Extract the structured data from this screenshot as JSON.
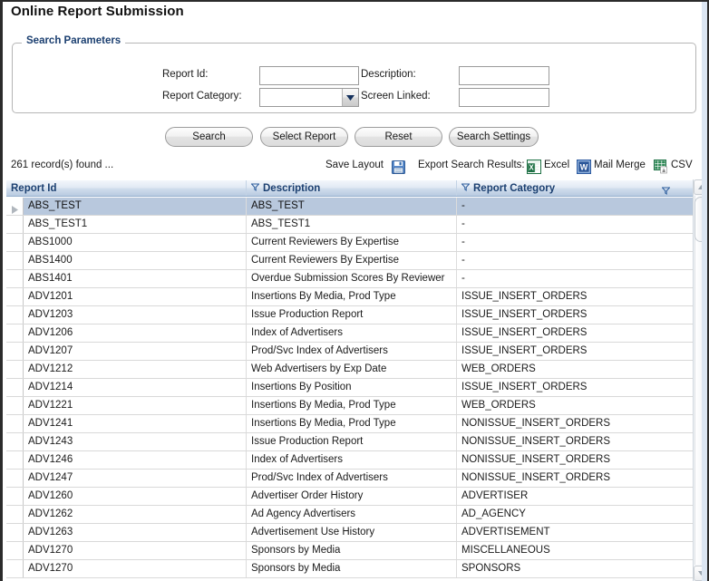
{
  "page": {
    "title": "Online Report Submission"
  },
  "search_panel": {
    "legend": "Search Parameters",
    "fields": {
      "report_id": {
        "label": "Report Id:",
        "value": "",
        "placeholder": ""
      },
      "report_category": {
        "label": "Report Category:",
        "value": "",
        "selected_option": ""
      },
      "description": {
        "label": "Description:",
        "value": "",
        "placeholder": ""
      },
      "screen_linked": {
        "label": "Screen Linked:",
        "value": "",
        "placeholder": ""
      }
    }
  },
  "buttons": {
    "search": "Search",
    "select_report": "Select Report",
    "reset": "Reset",
    "search_settings": "Search Settings"
  },
  "toolbar": {
    "record_count": "261 record(s) found ...",
    "save_layout_label": "Save Layout",
    "save_layout_icon": "floppy-disk-icon",
    "export_label": "Export Search Results:",
    "export_options": [
      {
        "label": "Excel",
        "icon": "excel-icon"
      },
      {
        "label": "Mail Merge",
        "icon": "word-icon"
      },
      {
        "label": "CSV",
        "icon": "csv-icon"
      }
    ]
  },
  "grid": {
    "columns": [
      {
        "key": "report_id",
        "label": "Report Id",
        "filter_icon": "funnel-icon",
        "filter_position": "right"
      },
      {
        "key": "description",
        "label": "Description",
        "filter_icon": "funnel-icon",
        "filter_position": "left"
      },
      {
        "key": "report_category",
        "label": "Report Category",
        "filter_icon": "funnel-icon",
        "filter_position": "left"
      }
    ],
    "selected_row_index": 0,
    "rows": [
      {
        "report_id": "ABS_TEST",
        "description": "ABS_TEST",
        "report_category": "-"
      },
      {
        "report_id": "ABS_TEST1",
        "description": "ABS_TEST1",
        "report_category": "-"
      },
      {
        "report_id": "ABS1000",
        "description": "Current Reviewers By Expertise",
        "report_category": "-"
      },
      {
        "report_id": "ABS1400",
        "description": "Current Reviewers By Expertise",
        "report_category": "-"
      },
      {
        "report_id": "ABS1401",
        "description": "Overdue Submission Scores By Reviewer",
        "report_category": "-"
      },
      {
        "report_id": "ADV1201",
        "description": "Insertions By Media, Prod Type",
        "report_category": "ISSUE_INSERT_ORDERS"
      },
      {
        "report_id": "ADV1203",
        "description": "Issue Production Report",
        "report_category": "ISSUE_INSERT_ORDERS"
      },
      {
        "report_id": "ADV1206",
        "description": "Index of Advertisers",
        "report_category": "ISSUE_INSERT_ORDERS"
      },
      {
        "report_id": "ADV1207",
        "description": "Prod/Svc Index of Advertisers",
        "report_category": "ISSUE_INSERT_ORDERS"
      },
      {
        "report_id": "ADV1212",
        "description": "Web Advertisers by Exp Date",
        "report_category": "WEB_ORDERS"
      },
      {
        "report_id": "ADV1214",
        "description": "Insertions By Position",
        "report_category": "ISSUE_INSERT_ORDERS"
      },
      {
        "report_id": "ADV1221",
        "description": "Insertions By Media, Prod Type",
        "report_category": "WEB_ORDERS"
      },
      {
        "report_id": "ADV1241",
        "description": "Insertions By Media, Prod Type",
        "report_category": "NONISSUE_INSERT_ORDERS"
      },
      {
        "report_id": "ADV1243",
        "description": "Issue Production Report",
        "report_category": "NONISSUE_INSERT_ORDERS"
      },
      {
        "report_id": "ADV1246",
        "description": "Index of Advertisers",
        "report_category": "NONISSUE_INSERT_ORDERS"
      },
      {
        "report_id": "ADV1247",
        "description": "Prod/Svc Index of Advertisers",
        "report_category": "NONISSUE_INSERT_ORDERS"
      },
      {
        "report_id": "ADV1260",
        "description": "Advertiser Order History",
        "report_category": "ADVERTISER"
      },
      {
        "report_id": "ADV1262",
        "description": "Ad Agency Advertisers",
        "report_category": "AD_AGENCY"
      },
      {
        "report_id": "ADV1263",
        "description": "Advertisement Use History",
        "report_category": "ADVERTISEMENT"
      },
      {
        "report_id": "ADV1270",
        "description": "Sponsors by Media",
        "report_category": "MISCELLANEOUS"
      },
      {
        "report_id": "ADV1270",
        "description": "Sponsors by Media",
        "report_category": "SPONSORS"
      }
    ]
  },
  "colors": {
    "header_text": "#1b3f70",
    "selected_row": "#b8c8dd",
    "panel_border": "#b5b5b5",
    "excel_green": "#1d7044",
    "word_blue": "#2b579a"
  }
}
